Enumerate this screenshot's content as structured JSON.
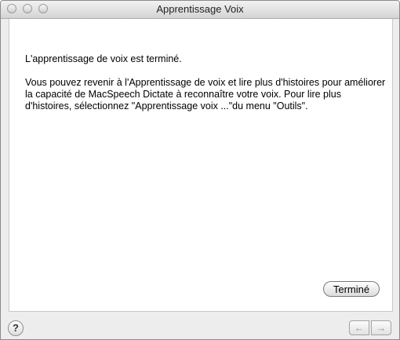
{
  "window": {
    "title": "Apprentissage Voix"
  },
  "content": {
    "paragraph1": "L'apprentissage de voix est terminé.",
    "paragraph2": "Vous pouvez revenir à l'Apprentissage de voix et lire plus d'histoires pour améliorer la capacité de MacSpeech Dictate à reconnaître votre voix. Pour lire plus d'histoires, sélectionnez \"Apprentissage voix ...\"du menu \"Outils\"."
  },
  "buttons": {
    "done_label": "Terminé",
    "help_label": "?",
    "back_icon": "arrow-left-icon",
    "forward_icon": "arrow-right-icon"
  }
}
